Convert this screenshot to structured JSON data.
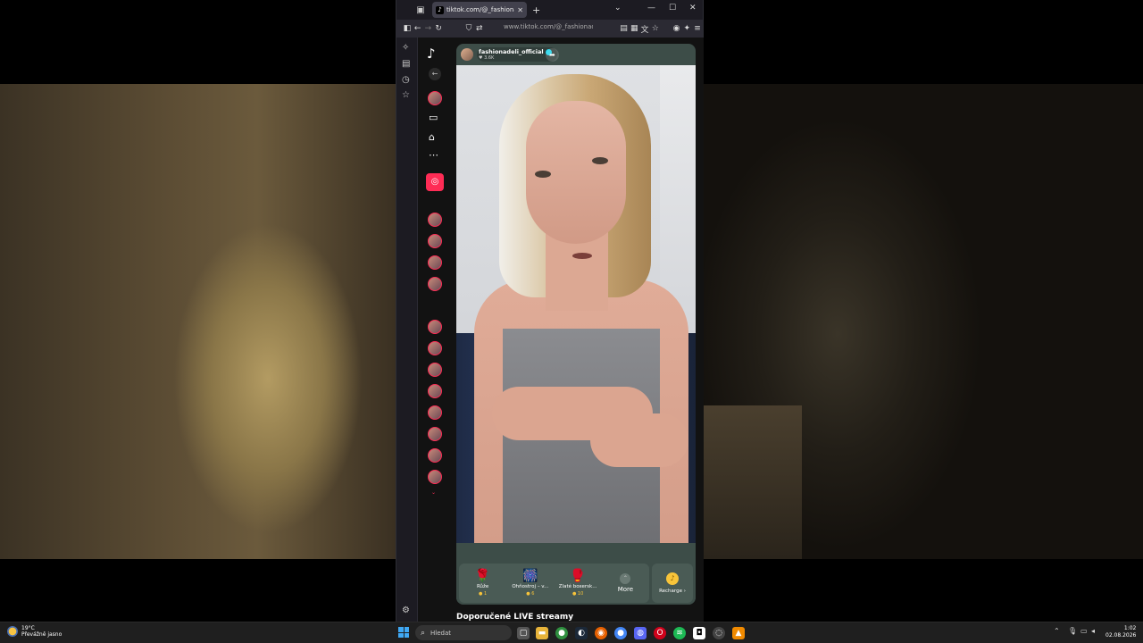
{
  "browser": {
    "tab_title": "tiktok.com/@_fashionadeli",
    "tab_close": "✕",
    "new_tab": "+",
    "url": "www.tiktok.com/@_fashionadel",
    "win_min": "—",
    "win_max": "☐",
    "win_close": "✕",
    "tab_list": "⌄"
  },
  "stream": {
    "host_name": "fashionadeli_official",
    "host_likes": "♥ 3.6K",
    "gifts": [
      {
        "icon": "🌹",
        "name": "Růže",
        "price": "● 1"
      },
      {
        "icon": "🎆",
        "name": "Ohňostroj – v...",
        "price": "● 6"
      },
      {
        "icon": "🥊",
        "name": "Zlaté boxersk...",
        "price": "● 10"
      }
    ],
    "more_label": "More",
    "recharge_label": "Recharge ›",
    "recommended_title": "Doporučené LIVE streamy"
  },
  "taskbar": {
    "weather_temp": "19°C",
    "weather_desc": "Převážně jasno",
    "search_placeholder": "Hledat",
    "time": "1:02",
    "date": "02.08.2026"
  },
  "colors": {
    "tiktok_accent": "#fe2c55",
    "stream_bg": "#3d4d48",
    "coin": "#f8c43a"
  }
}
